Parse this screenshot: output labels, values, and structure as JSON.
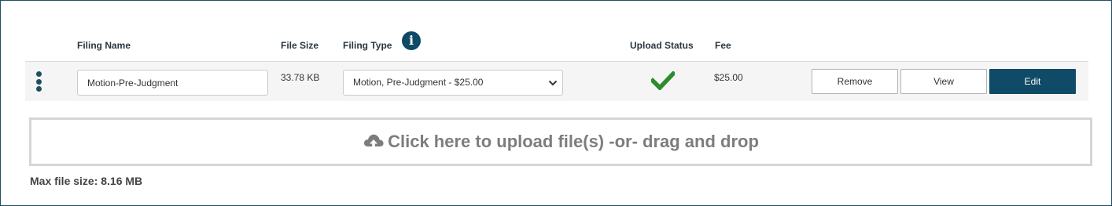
{
  "headers": {
    "filing_name": "Filing Name",
    "file_size": "File Size",
    "filing_type": "Filing Type",
    "upload_status": "Upload Status",
    "fee": "Fee"
  },
  "info_icon": {
    "glyph": "i",
    "name": "info-circle-icon",
    "color": "#0f4a66"
  },
  "row": {
    "filing_name_value": "Motion-Pre-Judgment",
    "file_size": "33.78 KB",
    "filing_type_selected": "Motion, Pre-Judgment - $25.00",
    "upload_status_icon": "checkmark-icon",
    "fee": "$25.00",
    "buttons": {
      "remove": "Remove",
      "view": "View",
      "edit": "Edit"
    }
  },
  "dropzone": {
    "label": "Click here to upload file(s) -or- drag and drop",
    "icon": "cloud-upload-icon"
  },
  "max_file_size": "Max file size: 8.16 MB",
  "colors": {
    "primary": "#0f4a66",
    "success": "#2e8b2e",
    "dropzone_text": "#7d7d7d"
  }
}
